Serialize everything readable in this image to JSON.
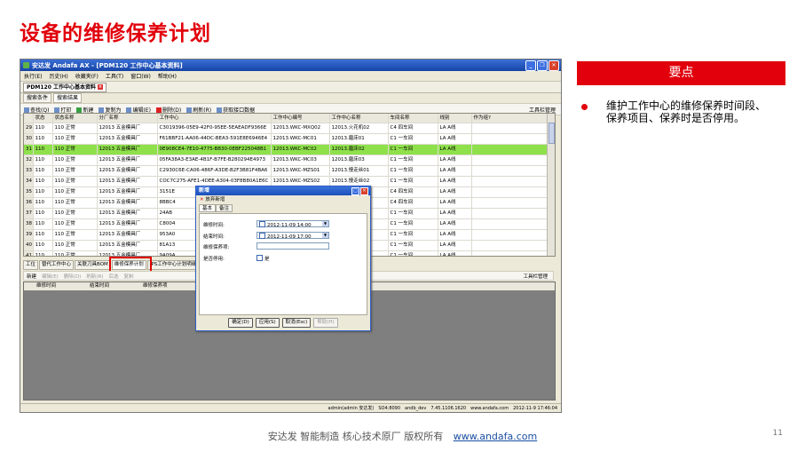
{
  "slide": {
    "title": "设备的维修保养计划",
    "panel_title": "要点",
    "panel_text": "维护工作中心的维修保养时间段、保养项目、保养时是否停用。",
    "footer_text": "安达发   智能制造 核心技术原厂   版权所有",
    "footer_link": "www.andafa.com",
    "page_number": "11",
    "accent_color": "#e1000b"
  },
  "app": {
    "window_title": "安达发 Andafa AX - [PDM120 工作中心基本资料]",
    "menu": [
      "执行(E)",
      "历史(H)",
      "收藏夹(F)",
      "工具(T)",
      "窗口(W)",
      "帮助(H)"
    ],
    "doc_tab": "PDM120 工作中心基本资料",
    "subtabs": [
      "搜索条件",
      "搜索结果"
    ],
    "toolbar": [
      "查找(Q)",
      "打印",
      "新建",
      "复制为",
      "编辑(E)",
      "删除(D)",
      "刷新(R)",
      "获取接口数据"
    ],
    "toolbar_right": "工具栏管理",
    "grid": {
      "columns": [
        "",
        "状态",
        "状态名称",
        "分厂名称",
        "工作中心",
        "工作中心编号",
        "工作中心名称",
        "车间名称",
        "线别",
        "作为组?"
      ],
      "rows": [
        {
          "no": "29",
          "status": "110",
          "status_name": "110 正常",
          "factory": "12013 五金模具厂",
          "center": "C3019396-05E9-42F0-95EE-5EAEADF9366E",
          "center_no": "12013.WKC-MXQ02",
          "center_name": "12013.火花机02",
          "workshop": "C4 四车间",
          "line": "LA A线"
        },
        {
          "no": "30",
          "status": "110",
          "status_name": "110 正常",
          "factory": "12013 五金模具厂",
          "center": "F61BBF21-AA06-44DC-BEA3-591E8E6946E4",
          "center_no": "12013.WKC-MC01",
          "center_name": "12013.磨床01",
          "workshop": "C1 一车间",
          "line": "LA A线"
        },
        {
          "no": "31",
          "status": "110",
          "status_name": "110 正常",
          "factory": "12013 五金模具厂",
          "center": "0E908CE4-7E10-4775-BB30-0EBF225048B1",
          "center_no": "12013.WKC-MC02",
          "center_name": "12013.磨床02",
          "workshop": "C1 一车间",
          "line": "LA A线"
        },
        {
          "no": "32",
          "status": "110",
          "status_name": "110 正常",
          "factory": "12013 五金模具厂",
          "center": "05FA38A3-E3AE-4B1F-B7FE-B280294E4973",
          "center_no": "12013.WKC-MC03",
          "center_name": "12013.磨床03",
          "workshop": "C1 一车间",
          "line": "LA A线"
        },
        {
          "no": "33",
          "status": "110",
          "status_name": "110 正常",
          "factory": "12013 五金模具厂",
          "center": "C2930C6E-CA06-486F-A3DE-B2F3B81F4BA6",
          "center_no": "12013.WKC-MZS01",
          "center_name": "12013.慢走丝01",
          "workshop": "C1 一车间",
          "line": "LA A线"
        },
        {
          "no": "34",
          "status": "110",
          "status_name": "110 正常",
          "factory": "12013 五金模具厂",
          "center": "COC7C275-AFE1-4DEE-A304-03F8B80A1E6C",
          "center_no": "12013.WKC-MZS02",
          "center_name": "12013.慢走丝02",
          "workshop": "C1 一车间",
          "line": "LA A线"
        },
        {
          "no": "35",
          "status": "110",
          "status_name": "110 正常",
          "factory": "12013 五金模具厂",
          "center": "3151E",
          "center_no": "",
          "center_name": "热处理01",
          "workshop": "C4 四车间",
          "line": "LA A线"
        },
        {
          "no": "36",
          "status": "110",
          "status_name": "110 正常",
          "factory": "12013 五金模具厂",
          "center": "8BBC4",
          "center_no": "",
          "center_name": "热处理02",
          "workshop": "C4 四车间",
          "line": "LA A线"
        },
        {
          "no": "37",
          "status": "110",
          "status_name": "110 正常",
          "factory": "12013 五金模具厂",
          "center": "24AB",
          "center_no": "",
          "center_name": "线切割1",
          "workshop": "C1 一车间",
          "line": "LA A线"
        },
        {
          "no": "38",
          "status": "110",
          "status_name": "110 正常",
          "factory": "12013 五金模具厂",
          "center": "C8004",
          "center_no": "",
          "center_name": "铣床01",
          "workshop": "C1 一车间",
          "line": "LA A线"
        },
        {
          "no": "39",
          "status": "110",
          "status_name": "110 正常",
          "factory": "12013 五金模具厂",
          "center": "953A0",
          "center_no": "",
          "center_name": "铣床02",
          "workshop": "C1 一车间",
          "line": "LA A线"
        },
        {
          "no": "40",
          "status": "110",
          "status_name": "110 正常",
          "factory": "12013 五金模具厂",
          "center": "81A13",
          "center_no": "",
          "center_name": "开粗01",
          "workshop": "C1 一车间",
          "line": "LA A线"
        },
        {
          "no": "41",
          "status": "110",
          "status_name": "110 正常",
          "factory": "12013 五金模具厂",
          "center": "9A09A",
          "center_no": "",
          "center_name": "铣床01",
          "workshop": "C1 一车间",
          "line": "LA A线"
        }
      ]
    },
    "lower_tabs": [
      "工位",
      "替代工作中心",
      "关联刀具BOM",
      "维修保养计划",
      "IPS工作中心计划明细"
    ],
    "lower_toolbar": [
      "新建",
      "编辑(E)",
      "删除(D)",
      "刷新(R)",
      "后选",
      "复制"
    ],
    "lower_toolbar_right": "工具栏管理",
    "lower_columns": [
      "维修时间",
      "结束时间",
      "维修保养项"
    ],
    "status_bar": [
      "admin(admin 安达发)",
      "SO4:8090",
      "andb_dev",
      "7.45.1106.1620",
      "www.andafa.com",
      "2012-11-9 17:46:04"
    ]
  },
  "dialog": {
    "title": "新增",
    "tool_label": "放弃新增",
    "tabs": [
      "基本",
      "备注"
    ],
    "fields": {
      "start_label": "维修时间:",
      "start_value": "2012-11-09 14:00",
      "end_label": "结束时间:",
      "end_value": "2012-11-09 17:00",
      "item_label": "维修保养项:",
      "item_value": "",
      "stop_label": "是否停用:",
      "stop_value": "是"
    },
    "buttons": [
      "确定(D)",
      "应用(S)",
      "取消(Esc)",
      "帮助(H)"
    ]
  }
}
